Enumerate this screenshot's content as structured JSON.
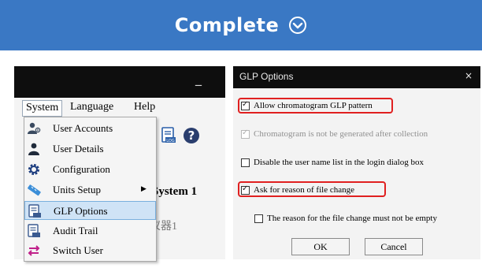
{
  "banner": {
    "title": "Complete",
    "icon": "chevron-down-circle-icon"
  },
  "app": {
    "minimize_label": "_",
    "menu": {
      "system": "System",
      "language": "Language",
      "help": "Help"
    },
    "partial_title": "System 1",
    "partial_subtitle": "仪器1",
    "system_menu": {
      "items": [
        {
          "label": "User Accounts",
          "icon": "user-accounts-icon"
        },
        {
          "label": "User Details",
          "icon": "user-details-icon"
        },
        {
          "label": "Configuration",
          "icon": "gear-icon"
        },
        {
          "label": "Units Setup",
          "icon": "units-setup-icon"
        },
        {
          "label": "GLP Options",
          "icon": "glp-options-icon"
        },
        {
          "label": "Audit Trail",
          "icon": "audit-trail-icon"
        },
        {
          "label": "Switch User",
          "icon": "switch-user-icon"
        }
      ]
    }
  },
  "dialog": {
    "title": "GLP Options",
    "close_label": "×",
    "options": [
      {
        "label": "Allow chromatogram GLP pattern",
        "checked": true,
        "disabled": false
      },
      {
        "label": "Chromatogram is not be generated after collection",
        "checked": true,
        "disabled": true
      },
      {
        "label": "Disable the user name list in the login dialog box",
        "checked": false,
        "disabled": false
      },
      {
        "label": "Ask for reason of file change",
        "checked": true,
        "disabled": false
      },
      {
        "label": "The reason for the file change must not be empty",
        "checked": false,
        "disabled": false
      }
    ],
    "ok_label": "OK",
    "cancel_label": "Cancel"
  },
  "colors": {
    "banner": "#3a78c4",
    "highlight": "#e02020",
    "selection": "#cfe3f6"
  }
}
